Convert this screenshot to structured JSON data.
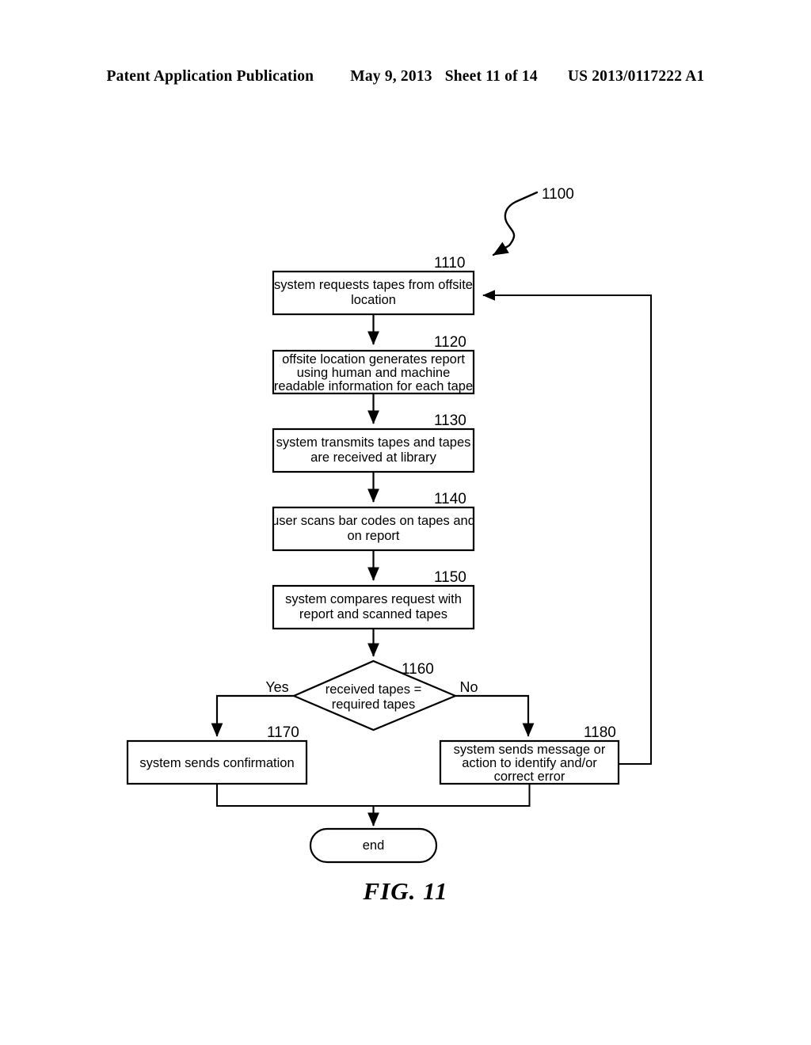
{
  "header": {
    "publication": "Patent Application Publication",
    "date": "May 9, 2013",
    "sheet": "Sheet 11 of 14",
    "patent_number": "US 2013/0117222 A1"
  },
  "figure": {
    "caption": "FIG. 11",
    "diagram_ref": "1100",
    "nodes": [
      {
        "id": "1110",
        "ref": "1110",
        "shape": "process",
        "lines": [
          "system requests tapes from offsite",
          "location"
        ]
      },
      {
        "id": "1120",
        "ref": "1120",
        "shape": "process",
        "lines": [
          "offsite location generates report",
          "using human and machine",
          "readable information for each tape"
        ]
      },
      {
        "id": "1130",
        "ref": "1130",
        "shape": "process",
        "lines": [
          "system transmits tapes and tapes",
          "are received at library"
        ]
      },
      {
        "id": "1140",
        "ref": "1140",
        "shape": "process",
        "lines": [
          "user scans bar codes on tapes and",
          "on report"
        ]
      },
      {
        "id": "1150",
        "ref": "1150",
        "shape": "process",
        "lines": [
          "system compares request with",
          "report and scanned tapes"
        ]
      },
      {
        "id": "1160",
        "ref": "1160",
        "shape": "decision",
        "lines": [
          "received tapes =",
          "required tapes"
        ]
      },
      {
        "id": "1170",
        "ref": "1170",
        "shape": "process",
        "lines": [
          "system sends confirmation"
        ]
      },
      {
        "id": "1180",
        "ref": "1180",
        "shape": "process",
        "lines": [
          "system sends message or",
          "action to identify and/or",
          "correct error"
        ]
      },
      {
        "id": "end",
        "ref": "",
        "shape": "terminator",
        "lines": [
          "end"
        ]
      }
    ],
    "branch_labels": {
      "yes": "Yes",
      "no": "No"
    }
  },
  "colors": {
    "ink": "#000000",
    "paper": "#ffffff"
  }
}
